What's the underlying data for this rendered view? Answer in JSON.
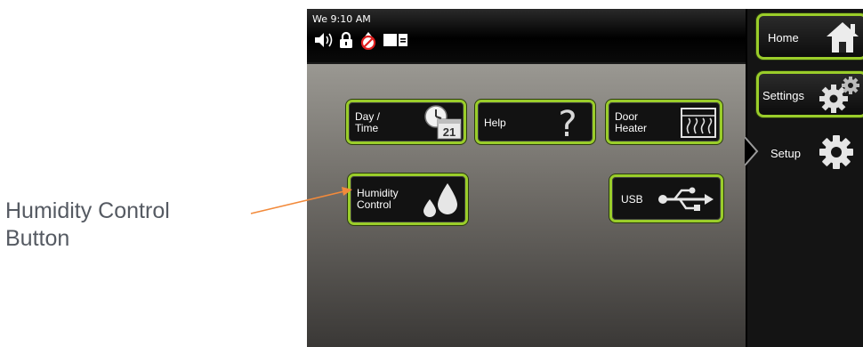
{
  "callout": {
    "line1": "Humidity Control",
    "line2": "Button"
  },
  "statusbar": {
    "time": "We 9:10 AM",
    "icons": [
      "speaker-icon",
      "lock-icon",
      "no-water-icon",
      "door-icon"
    ]
  },
  "buttons": {
    "day_time": {
      "line1": "Day /",
      "line2": "Time",
      "badge": "21"
    },
    "help": {
      "label": "Help"
    },
    "door_heater": {
      "line1": "Door",
      "line2": "Heater"
    },
    "humidity": {
      "line1": "Humidity",
      "line2": "Control"
    },
    "usb": {
      "label": "USB"
    }
  },
  "sidebar": {
    "home": "Home",
    "settings": "Settings",
    "setup": "Setup"
  },
  "colors": {
    "accent": "#9acd2a",
    "callout_arrow": "#f28a3b"
  }
}
